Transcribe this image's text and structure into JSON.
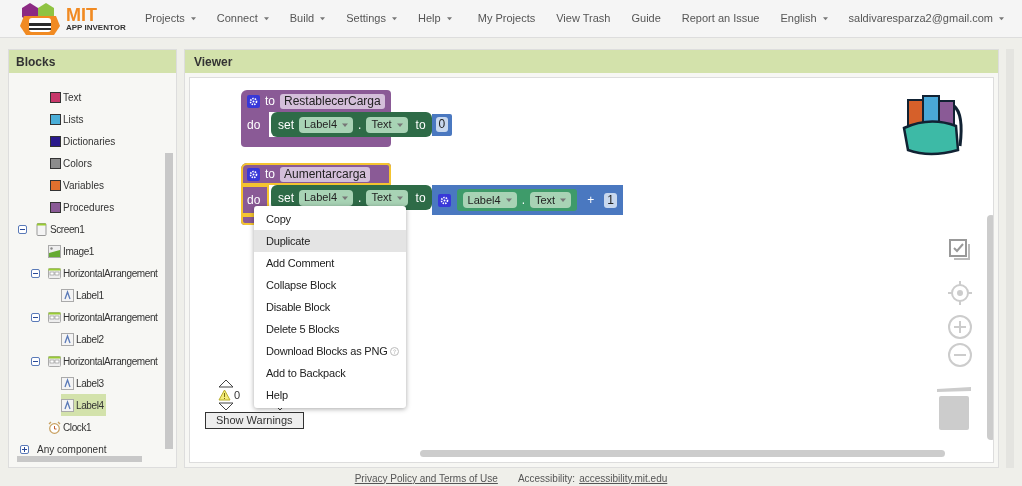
{
  "header": {
    "logo": {
      "title": "MIT",
      "subtitle": "APP INVENTOR"
    },
    "menus": [
      {
        "label": "Projects",
        "dropdown": true
      },
      {
        "label": "Connect",
        "dropdown": true
      },
      {
        "label": "Build",
        "dropdown": true
      },
      {
        "label": "Settings",
        "dropdown": true
      },
      {
        "label": "Help",
        "dropdown": true
      }
    ],
    "right_links": [
      {
        "label": "My Projects",
        "dropdown": false
      },
      {
        "label": "View Trash",
        "dropdown": false
      },
      {
        "label": "Guide",
        "dropdown": false
      },
      {
        "label": "Report an Issue",
        "dropdown": false
      },
      {
        "label": "English",
        "dropdown": true
      },
      {
        "label": "saldivaresparza2@gmail.com",
        "dropdown": true
      }
    ]
  },
  "blocks_panel": {
    "title": "Blocks",
    "items": [
      {
        "kind": "builtin",
        "label": "Text",
        "color": "#c8386a"
      },
      {
        "kind": "builtin",
        "label": "Lists",
        "color": "#4aaed8"
      },
      {
        "kind": "builtin",
        "label": "Dictionaries",
        "color": "#2a1a8c"
      },
      {
        "kind": "builtin",
        "label": "Colors",
        "color": "#8c8c8c"
      },
      {
        "kind": "builtin",
        "label": "Variables",
        "color": "#e2702e"
      },
      {
        "kind": "builtin",
        "label": "Procedures",
        "color": "#8a5a96"
      },
      {
        "kind": "screen",
        "label": "Screen1",
        "expanded": true,
        "selected": false,
        "children": [
          {
            "kind": "image",
            "label": "Image1",
            "selected": false
          },
          {
            "kind": "arrangement",
            "label": "HorizontalArrangement",
            "expanded": true,
            "selected": false,
            "children": [
              {
                "kind": "label",
                "label": "Label1",
                "selected": false
              }
            ]
          },
          {
            "kind": "arrangement",
            "label": "HorizontalArrangement",
            "expanded": true,
            "selected": false,
            "children": [
              {
                "kind": "label",
                "label": "Label2",
                "selected": false
              }
            ]
          },
          {
            "kind": "arrangement",
            "label": "HorizontalArrangement",
            "expanded": true,
            "selected": false,
            "children": [
              {
                "kind": "label",
                "label": "Label3",
                "selected": false
              },
              {
                "kind": "label",
                "label": "Label4",
                "selected": true
              }
            ]
          },
          {
            "kind": "clock",
            "label": "Clock1",
            "selected": false
          }
        ]
      },
      {
        "kind": "group",
        "label": "Any component",
        "expanded": false
      }
    ]
  },
  "viewer": {
    "title": "Viewer",
    "procedures": [
      {
        "keyword": "to",
        "name": "RestablecerCarga",
        "do_keyword": "do",
        "selected": false,
        "statement": {
          "keyword": "set",
          "component": "Label4",
          "dot": ".",
          "property": "Text",
          "to_keyword": "to",
          "value": {
            "kind": "number",
            "text": "0"
          }
        }
      },
      {
        "keyword": "to",
        "name": "Aumentarcarga",
        "do_keyword": "do",
        "selected": true,
        "statement": {
          "keyword": "set",
          "component": "Label4",
          "dot": ".",
          "property": "Text",
          "to_keyword": "to",
          "value": {
            "kind": "add",
            "getter": {
              "component": "Label4",
              "dot": ".",
              "property": "Text"
            },
            "operator": "+",
            "number": "1"
          }
        }
      }
    ],
    "context_menu": [
      {
        "label": "Copy",
        "selected": false,
        "help": false
      },
      {
        "label": "Duplicate",
        "selected": true,
        "help": false
      },
      {
        "label": "Add Comment",
        "selected": false,
        "help": false
      },
      {
        "label": "Collapse Block",
        "selected": false,
        "help": false
      },
      {
        "label": "Disable Block",
        "selected": false,
        "help": false
      },
      {
        "label": "Delete 5 Blocks",
        "selected": false,
        "help": false
      },
      {
        "label": "Download Blocks as PNG",
        "selected": false,
        "help": true
      },
      {
        "label": "Add to Backpack",
        "selected": false,
        "help": false
      },
      {
        "label": "Help",
        "selected": false,
        "help": false
      }
    ],
    "warnings": {
      "count": "0",
      "button": "Show Warnings"
    }
  },
  "footer": {
    "links": [
      {
        "kind": "link",
        "text": "Privacy Policy and Terms of Use"
      },
      {
        "kind": "label",
        "text": "Accessibility:"
      },
      {
        "kind": "link",
        "text": "accessibility.mit.edu"
      }
    ]
  }
}
